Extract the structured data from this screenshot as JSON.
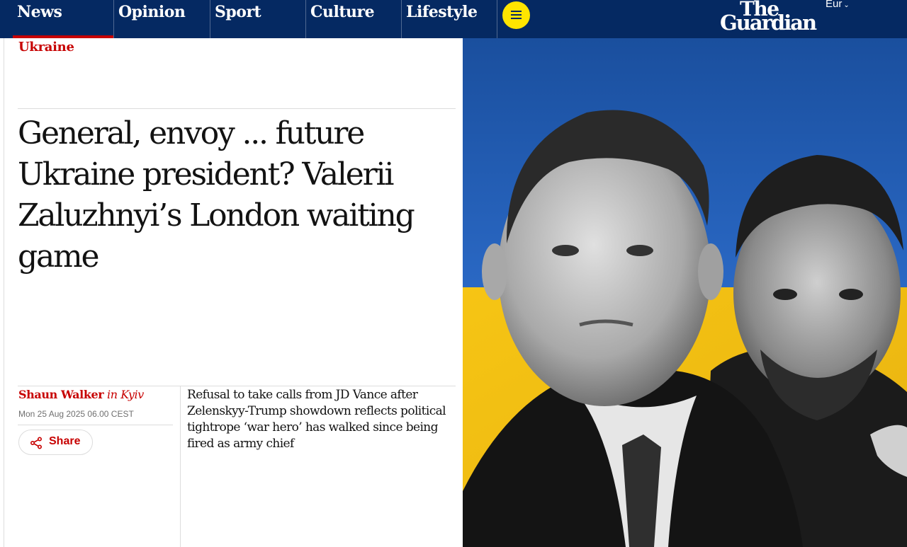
{
  "nav": {
    "items": [
      {
        "label": "News",
        "active": true
      },
      {
        "label": "Opinion",
        "active": false
      },
      {
        "label": "Sport",
        "active": false
      },
      {
        "label": "Culture",
        "active": false
      },
      {
        "label": "Lifestyle",
        "active": false
      }
    ],
    "menu_icon": "hamburger-icon",
    "logo_line1": "The",
    "logo_line2": "Guardian",
    "edition": "Eur"
  },
  "article": {
    "section": "Ukraine",
    "headline": "General, envoy ... future Ukraine president? Valerii Zaluzhnyi’s London waiting game",
    "author": "Shaun Walker",
    "location": "in Kyiv",
    "date": "Mon 25 Aug 2025 06.00 CEST",
    "share_label": "Share",
    "standfirst": "Refusal to take calls from JD Vance after Zelenskyy-Trump showdown reflects political tightrope ‘war hero’ has walked since being fired as army chief"
  },
  "colors": {
    "nav_bg": "#052962",
    "news_accent": "#c70000",
    "menu_button": "#ffe500",
    "flag_blue": "#1f5bb5",
    "flag_yellow": "#f4c418"
  }
}
